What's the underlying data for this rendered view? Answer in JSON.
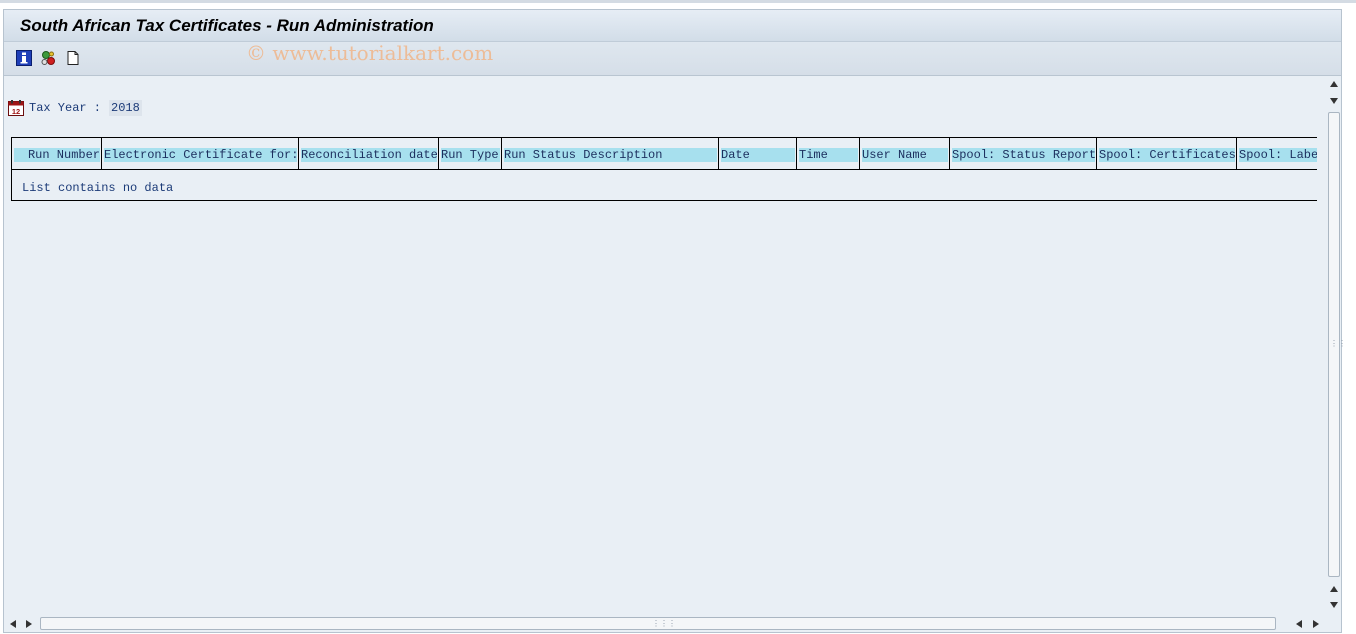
{
  "window": {
    "title": "South African Tax Certificates - Run Administration",
    "watermark": "© www.tutorialkart.com"
  },
  "toolbar": {
    "buttons": [
      {
        "icon": "info-icon"
      },
      {
        "icon": "execute-icon"
      },
      {
        "icon": "new-document-icon"
      }
    ]
  },
  "tax_year": {
    "label": "Tax Year :",
    "value": "2018",
    "icon": "calendar-icon"
  },
  "list": {
    "columns": [
      "Run Number",
      "Electronic Certificate for:",
      "Reconciliation date",
      "Run Type",
      "Run Status Description",
      "Date",
      "Time",
      "User Name",
      "Spool: Status Report",
      "Spool: Certificates",
      "Spool: Labe"
    ],
    "empty_message": "List contains no data"
  },
  "colors": {
    "header_bg": "#a7e0ee",
    "text_blue": "#1c3b78",
    "watermark": "#f0b68a"
  }
}
